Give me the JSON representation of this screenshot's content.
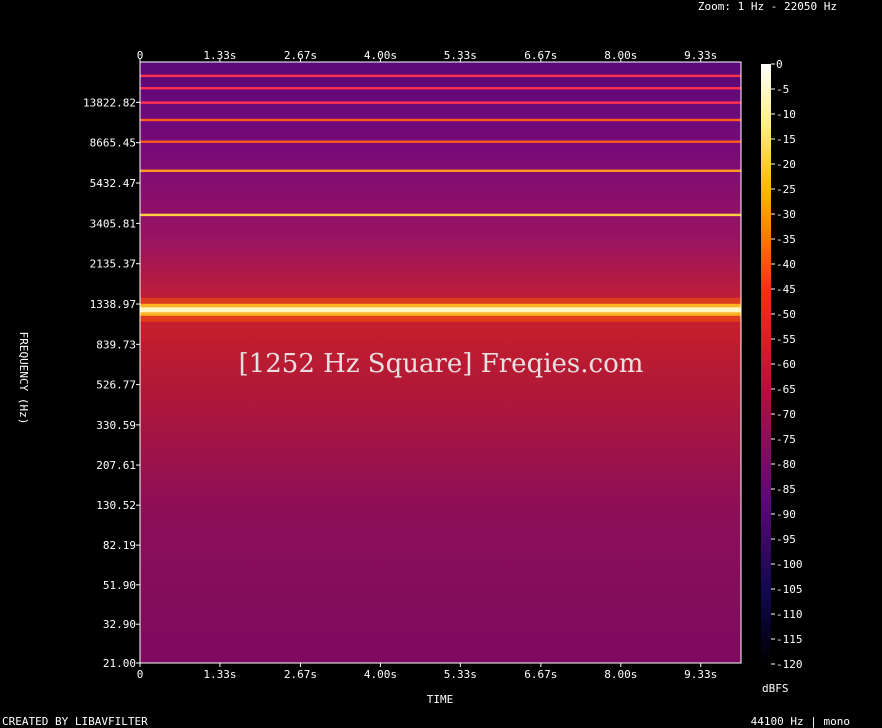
{
  "header": {
    "zoom": "Zoom: 1 Hz - 22050 Hz"
  },
  "footer": {
    "created": "CREATED BY LIBAVFILTER",
    "info": "44100 Hz | mono"
  },
  "watermark": "[1252 Hz Square] Freqies.com",
  "colors": {
    "background": "#000000",
    "axis": "#ffffff"
  },
  "chart_data": {
    "type": "heatmap",
    "xlabel": "TIME",
    "ylabel": "FREQUENCY (Hz)",
    "x_ticks": [
      "0",
      "1.33s",
      "2.67s",
      "4.00s",
      "5.33s",
      "6.67s",
      "8.00s",
      "9.33s"
    ],
    "x_tick_seconds": [
      0,
      1.33,
      2.67,
      4.0,
      5.33,
      6.67,
      8.0,
      9.33
    ],
    "xlim": [
      0,
      10
    ],
    "y_ticks": [
      "21.00",
      "32.90",
      "51.90",
      "82.19",
      "130.52",
      "207.61",
      "330.59",
      "526.77",
      "839.73",
      "1338.97",
      "2135.37",
      "3405.81",
      "5432.47",
      "8665.45",
      "13822.82"
    ],
    "y_tick_values": [
      21,
      32.9,
      51.9,
      82.19,
      130.52,
      207.61,
      330.59,
      526.77,
      839.73,
      1338.97,
      2135.37,
      3405.81,
      5432.47,
      8665.45,
      13822.82
    ],
    "ylim": [
      21,
      22050
    ],
    "y_scale": "log",
    "colorbar_label": "dBFS",
    "colorbar_ticks": [
      "0",
      "-5",
      "-10",
      "-15",
      "-20",
      "-25",
      "-30",
      "-35",
      "-40",
      "-45",
      "-50",
      "-55",
      "-60",
      "-65",
      "-70",
      "-75",
      "-80",
      "-85",
      "-90",
      "-95",
      "-100",
      "-105",
      "-110",
      "-115",
      "-120"
    ],
    "colorbar_range": [
      0,
      -120
    ],
    "harmonics_hz": [
      1252,
      3756,
      6260,
      8764,
      11268,
      13772,
      16276,
      18780
    ],
    "harmonics_dbfs": [
      -1,
      -18,
      -25,
      -40,
      -45,
      -52,
      -58,
      -62
    ]
  }
}
